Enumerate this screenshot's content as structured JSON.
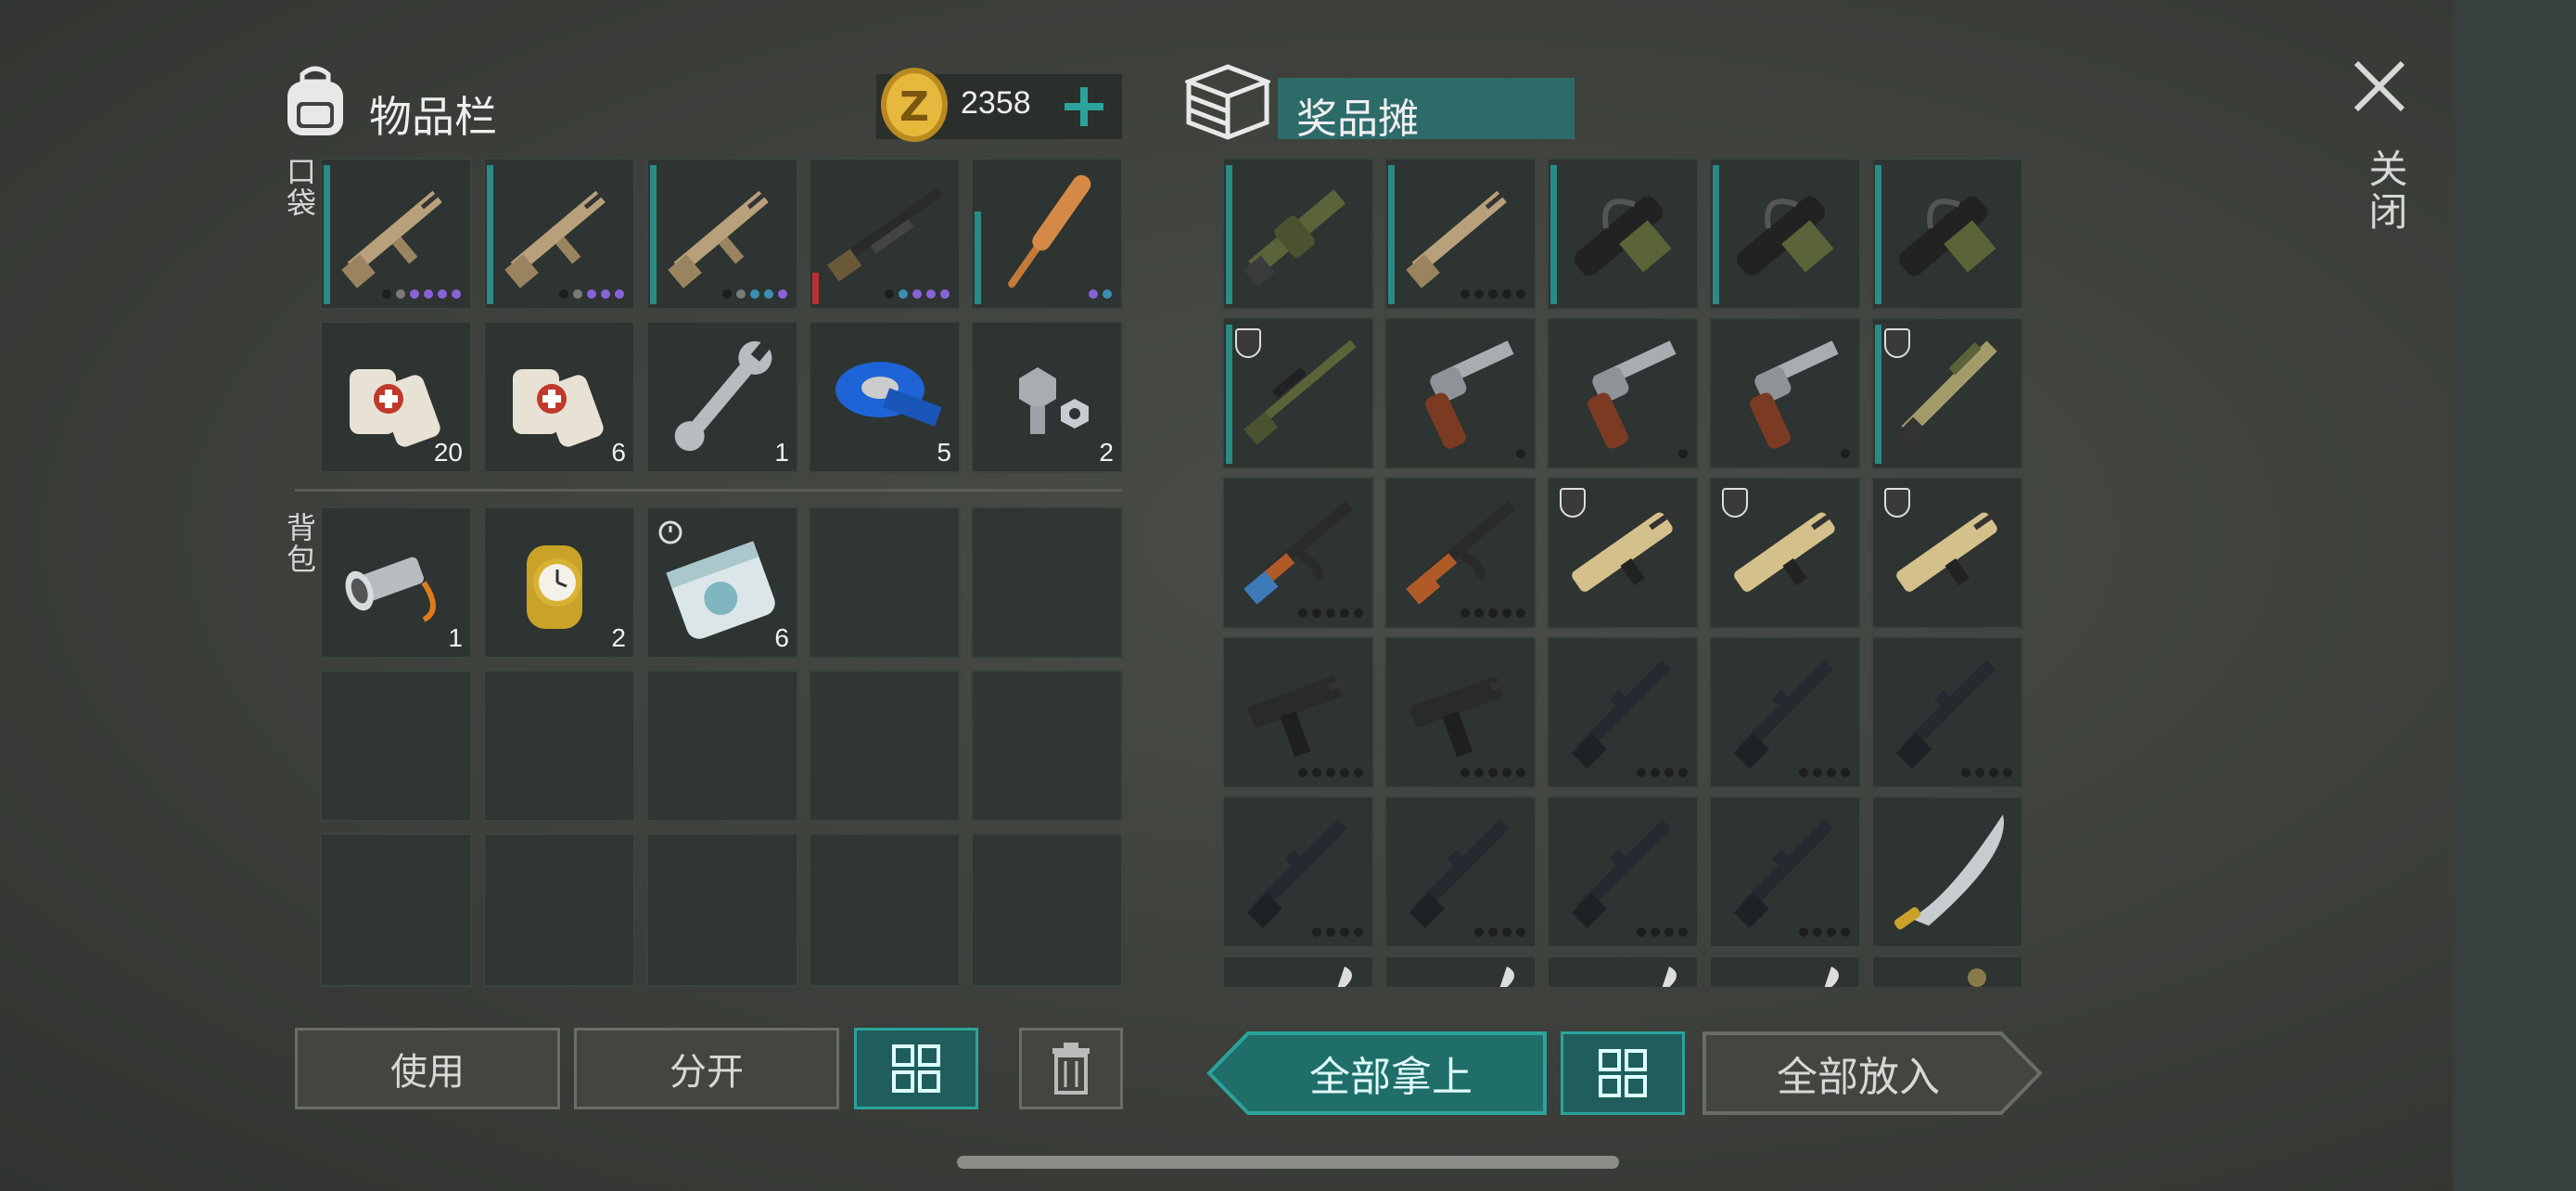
{
  "inventory": {
    "title": "物品栏",
    "coins": "2358",
    "pocket_label": "口袋",
    "backpack_label": "背包",
    "pocket_row1": [
      {
        "item": "rifle-tan",
        "dots": [
          "d",
          "g",
          "p",
          "p",
          "p",
          "p"
        ]
      },
      {
        "item": "rifle-tan",
        "dots": [
          "d",
          "g",
          "p",
          "p",
          "p"
        ]
      },
      {
        "item": "rifle-tan",
        "dots": [
          "d",
          "g",
          "b",
          "b",
          "p"
        ]
      },
      {
        "item": "shotgun",
        "dots": [
          "d",
          "b",
          "p",
          "p",
          "p"
        ]
      },
      {
        "item": "baseball-bat",
        "dots": [
          "p",
          "b"
        ]
      }
    ],
    "pocket_row2": [
      {
        "item": "bandage",
        "count": "20"
      },
      {
        "item": "bandage",
        "count": "6"
      },
      {
        "item": "wrench",
        "count": "1"
      },
      {
        "item": "tape",
        "count": "5"
      },
      {
        "item": "bolts",
        "count": "2"
      }
    ],
    "backpack": [
      {
        "item": "flashlight",
        "count": "1"
      },
      {
        "item": "watch",
        "count": "2"
      },
      {
        "item": "seed-bag",
        "count": "6"
      }
    ]
  },
  "prize_stall": {
    "title": "奖品摊",
    "grid": [
      [
        "grenade-launcher",
        "rifle-tan",
        "minigun",
        "minigun",
        "minigun"
      ],
      [
        "sniper-rifle",
        "revolver",
        "revolver",
        "revolver",
        "shotgun-tan"
      ],
      [
        "ak47",
        "ak47",
        "rifle-sand",
        "rifle-sand",
        "rifle-sand"
      ],
      [
        "uzi",
        "uzi",
        "m16",
        "m16",
        "m16"
      ],
      [
        "m16",
        "m16",
        "m16",
        "m16",
        "machete"
      ]
    ]
  },
  "buttons": {
    "use": "使用",
    "split": "分开",
    "take_all": "全部拿上",
    "put_all": "全部放入"
  },
  "close_label": "关闭",
  "colors": {
    "accent": "#2ba39b",
    "panel": "#2d3431",
    "coin": "#e2b43a"
  }
}
